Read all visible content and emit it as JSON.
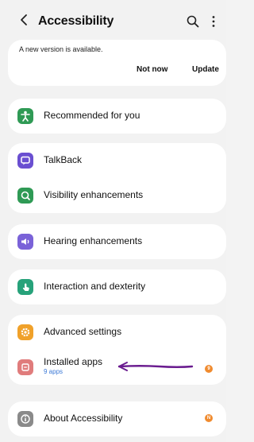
{
  "header": {
    "title": "Accessibility"
  },
  "update": {
    "message": "A new version is available.",
    "not_now": "Not now",
    "update": "Update"
  },
  "items": {
    "recommended": "Recommended for you",
    "talkback": "TalkBack",
    "visibility": "Visibility enhancements",
    "hearing": "Hearing enhancements",
    "interaction": "Interaction and dexterity",
    "advanced": "Advanced settings",
    "installed": "Installed apps",
    "installed_sub": "9 apps",
    "about": "About Accessibility"
  },
  "badges": {
    "installed": "9",
    "about": "N"
  },
  "colors": {
    "recommended": "#2f9a55",
    "talkback": "#6a4fd1",
    "visibility": "#2f9a55",
    "hearing": "#7a62d8",
    "interaction": "#27a27a",
    "advanced": "#f0a12a",
    "installed": "#e07c7c",
    "about": "#8a8a8a",
    "arrow": "#6a1c8f"
  },
  "icons": {
    "back": "chevron-left-icon",
    "search": "search-icon",
    "more": "more-vert-icon",
    "recommended": "accessibility-person-icon",
    "talkback": "chat-bubble-icon",
    "visibility": "magnifier-icon",
    "hearing": "speaker-icon",
    "interaction": "touch-hand-icon",
    "advanced": "gear-icon",
    "installed": "apps-icon",
    "about": "info-icon"
  }
}
